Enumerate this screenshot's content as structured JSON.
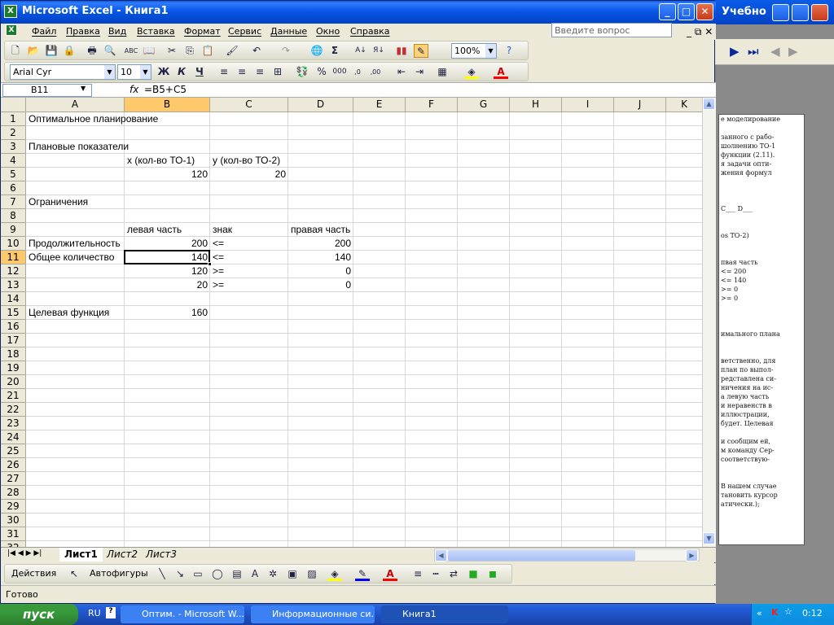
{
  "excel": {
    "title": "Microsoft Excel - Книга1",
    "menu": [
      "Файл",
      "Правка",
      "Вид",
      "Вставка",
      "Формат",
      "Сервис",
      "Данные",
      "Окно",
      "Справка"
    ],
    "ask_placeholder": "Введите вопрос",
    "zoom": "100%",
    "font_name": "Arial Cyr",
    "font_size": "10",
    "name_box": "B11",
    "fx": "fx",
    "formula": "=B5+C5",
    "columns": [
      "A",
      "B",
      "C",
      "D",
      "E",
      "F",
      "G",
      "H",
      "I",
      "J",
      "K"
    ],
    "cells": [
      {
        "row": 1,
        "col": "A",
        "v": "Оптимальное планирование"
      },
      {
        "row": 3,
        "col": "A",
        "v": "Плановые показатели"
      },
      {
        "row": 4,
        "col": "B",
        "v": "x (кол-во ТО-1)"
      },
      {
        "row": 4,
        "col": "C",
        "v": "y (кол-во ТО-2)"
      },
      {
        "row": 5,
        "col": "B",
        "v": "120",
        "align": "r"
      },
      {
        "row": 5,
        "col": "C",
        "v": "20",
        "align": "r"
      },
      {
        "row": 7,
        "col": "A",
        "v": "Ограничения"
      },
      {
        "row": 9,
        "col": "B",
        "v": "левая часть"
      },
      {
        "row": 9,
        "col": "C",
        "v": "знак"
      },
      {
        "row": 9,
        "col": "D",
        "v": "правая часть"
      },
      {
        "row": 10,
        "col": "A",
        "v": "Продолжительность"
      },
      {
        "row": 10,
        "col": "B",
        "v": "200",
        "align": "r"
      },
      {
        "row": 10,
        "col": "C",
        "v": "<="
      },
      {
        "row": 10,
        "col": "D",
        "v": "200",
        "align": "r"
      },
      {
        "row": 11,
        "col": "A",
        "v": "Общее количество"
      },
      {
        "row": 11,
        "col": "B",
        "v": "140",
        "align": "r"
      },
      {
        "row": 11,
        "col": "C",
        "v": "<="
      },
      {
        "row": 11,
        "col": "D",
        "v": "140",
        "align": "r"
      },
      {
        "row": 12,
        "col": "B",
        "v": "120",
        "align": "r"
      },
      {
        "row": 12,
        "col": "C",
        "v": ">="
      },
      {
        "row": 12,
        "col": "D",
        "v": "0",
        "align": "r"
      },
      {
        "row": 13,
        "col": "B",
        "v": "20",
        "align": "r"
      },
      {
        "row": 13,
        "col": "C",
        "v": ">="
      },
      {
        "row": 13,
        "col": "D",
        "v": "0",
        "align": "r"
      },
      {
        "row": 15,
        "col": "A",
        "v": "Целевая функция"
      },
      {
        "row": 15,
        "col": "B",
        "v": "160",
        "align": "r"
      }
    ],
    "sheet_tabs": [
      "Лист1",
      "Лист2",
      "Лист3"
    ],
    "draw_actions": "Действия",
    "draw_autoshapes": "Автофигуры",
    "status": "Готово"
  },
  "bg_window": {
    "title": "Учебно",
    "page_lines": [
      "е моделирование",
      "",
      "занного с рабо-",
      "шолнению ТО-1",
      "функции (2.11).",
      "я задачи опти-",
      "жения формул",
      "",
      "",
      "",
      "C___ D___",
      "",
      "",
      "os TO-2)",
      "",
      "",
      "пвая часть",
      "<=    200",
      "<=    140",
      ">=    0",
      ">=    0",
      "",
      "",
      "",
      "имального плана",
      "",
      "",
      "ветственно, для",
      "план по выпол-",
      "редставлена си-",
      "ничения на ис-",
      "а левую часть",
      "и неравенств в",
      "иллюстрации,",
      "будет. Целевая",
      "",
      "и сообщим ей,",
      "м команду Сер-",
      "соответствую-",
      "",
      "",
      "В нашем случае",
      "тановить курсор",
      "атически.);"
    ]
  },
  "taskbar": {
    "start": "пуск",
    "lang": "RU",
    "tasks": [
      "Оптим. - Microsoft W...",
      "Информационные си...",
      "Книга1"
    ],
    "clock": "0:12"
  }
}
